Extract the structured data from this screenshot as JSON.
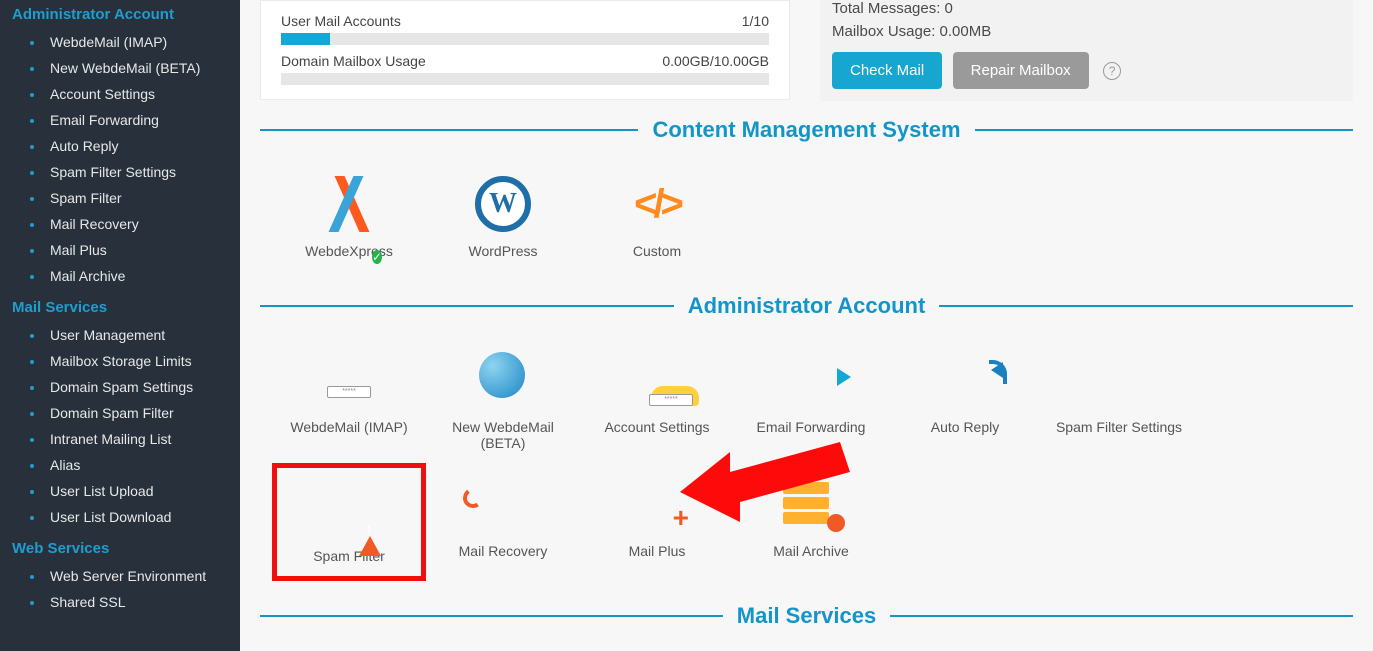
{
  "sidebar": {
    "groups": [
      {
        "title": "Administrator Account",
        "items": [
          "WebdeMail (IMAP)",
          "New WebdeMail (BETA)",
          "Account Settings",
          "Email Forwarding",
          "Auto Reply",
          "Spam Filter Settings",
          "Spam Filter",
          "Mail Recovery",
          "Mail Plus",
          "Mail Archive"
        ]
      },
      {
        "title": "Mail Services",
        "items": [
          "User Management",
          "Mailbox Storage Limits",
          "Domain Spam Settings",
          "Domain Spam Filter",
          "Intranet Mailing List",
          "Alias",
          "User List Upload",
          "User List Download"
        ]
      },
      {
        "title": "Web Services",
        "items": [
          "Web Server Environment",
          "Shared SSL"
        ]
      }
    ]
  },
  "usage": {
    "rows": [
      {
        "label": "User Mail Accounts",
        "value": "1/10"
      },
      {
        "label": "Domain Mailbox Usage",
        "value": "0.00GB/10.00GB"
      }
    ]
  },
  "mailbox": {
    "total_label": "Total Messages: 0",
    "usage_label": "Mailbox Usage: 0.00MB",
    "check_btn": "Check Mail",
    "repair_btn": "Repair Mailbox"
  },
  "sections": {
    "cms": {
      "title": "Content Management System",
      "apps": [
        {
          "label": "WebdeXpress"
        },
        {
          "label": "WordPress"
        },
        {
          "label": "Custom"
        }
      ]
    },
    "admin": {
      "title": "Administrator Account",
      "apps": [
        {
          "label": "WebdeMail (IMAP)"
        },
        {
          "label": "New WebdeMail (BETA)"
        },
        {
          "label": "Account Settings"
        },
        {
          "label": "Email Forwarding"
        },
        {
          "label": "Auto Reply"
        },
        {
          "label": "Spam Filter Settings"
        },
        {
          "label": "Spam Filter"
        },
        {
          "label": "Mail Recovery"
        },
        {
          "label": "Mail Plus"
        },
        {
          "label": "Mail Archive"
        }
      ]
    },
    "mailservices": {
      "title": "Mail Services"
    }
  }
}
